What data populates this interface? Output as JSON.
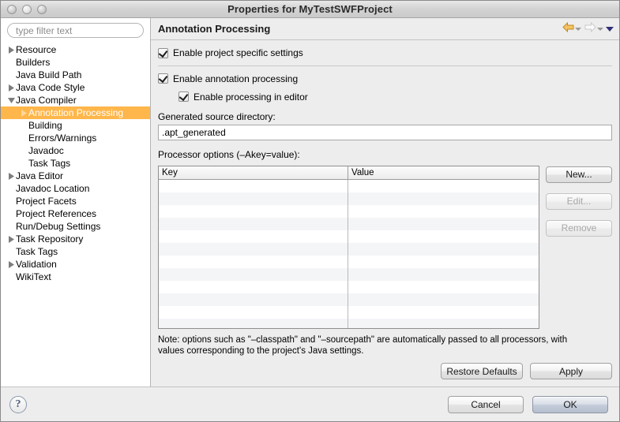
{
  "window": {
    "title": "Properties for MyTestSWFProject",
    "controls": [
      "close-button",
      "minimize-button",
      "zoom-button"
    ]
  },
  "sidebar": {
    "filter": {
      "value": "",
      "placeholder": "type filter text"
    },
    "items": [
      {
        "label": "Resource",
        "depth": 0,
        "twisty": "collapsed",
        "selected": false
      },
      {
        "label": "Builders",
        "depth": 0,
        "twisty": "none",
        "selected": false
      },
      {
        "label": "Java Build Path",
        "depth": 0,
        "twisty": "none",
        "selected": false
      },
      {
        "label": "Java Code Style",
        "depth": 0,
        "twisty": "collapsed",
        "selected": false
      },
      {
        "label": "Java Compiler",
        "depth": 0,
        "twisty": "expanded",
        "selected": false
      },
      {
        "label": "Annotation Processing",
        "depth": 1,
        "twisty": "collapsed",
        "selected": true
      },
      {
        "label": "Building",
        "depth": 1,
        "twisty": "none",
        "selected": false
      },
      {
        "label": "Errors/Warnings",
        "depth": 1,
        "twisty": "none",
        "selected": false
      },
      {
        "label": "Javadoc",
        "depth": 1,
        "twisty": "none",
        "selected": false
      },
      {
        "label": "Task Tags",
        "depth": 1,
        "twisty": "none",
        "selected": false
      },
      {
        "label": "Java Editor",
        "depth": 0,
        "twisty": "collapsed",
        "selected": false
      },
      {
        "label": "Javadoc Location",
        "depth": 0,
        "twisty": "none",
        "selected": false
      },
      {
        "label": "Project Facets",
        "depth": 0,
        "twisty": "none",
        "selected": false
      },
      {
        "label": "Project References",
        "depth": 0,
        "twisty": "none",
        "selected": false
      },
      {
        "label": "Run/Debug Settings",
        "depth": 0,
        "twisty": "none",
        "selected": false
      },
      {
        "label": "Task Repository",
        "depth": 0,
        "twisty": "collapsed",
        "selected": false
      },
      {
        "label": "Task Tags",
        "depth": 0,
        "twisty": "none",
        "selected": false
      },
      {
        "label": "Validation",
        "depth": 0,
        "twisty": "collapsed",
        "selected": false
      },
      {
        "label": "WikiText",
        "depth": 0,
        "twisty": "none",
        "selected": false
      }
    ]
  },
  "page": {
    "title": "Annotation Processing",
    "nav": {
      "back_icon": "back-arrow-icon",
      "back_enabled": true,
      "forward_icon": "forward-arrow-icon",
      "forward_enabled": false,
      "menu_icon": "chevron-down-icon"
    },
    "checkboxes": [
      {
        "label": "Enable project specific settings",
        "checked": true
      },
      {
        "label": "Enable annotation processing",
        "checked": true
      },
      {
        "label": "Enable processing in editor",
        "checked": true
      }
    ],
    "generated_dir": {
      "label": "Generated source directory:",
      "value": ".apt_generated",
      "placeholder": ""
    },
    "processor_options": {
      "label": "Processor options (–Akey=value):",
      "columns": [
        "Key",
        "Value"
      ],
      "rows": [],
      "row_count": 12
    },
    "side_buttons": [
      {
        "label": "New...",
        "enabled": true
      },
      {
        "label": "Edit...",
        "enabled": false
      },
      {
        "label": "Remove",
        "enabled": false
      }
    ],
    "note_line1": "Note: options such as \"–classpath\" and \"–sourcepath\" are automatically passed to all processors, with",
    "note_line2": "values corresponding to the project's Java settings.",
    "apply_buttons": [
      {
        "label": "Restore Defaults",
        "enabled": true
      },
      {
        "label": "Apply",
        "enabled": true
      }
    ]
  },
  "footer": {
    "help_label": "?",
    "buttons": [
      {
        "label": "Cancel",
        "default": false
      },
      {
        "label": "OK",
        "default": true
      }
    ]
  },
  "colors": {
    "selection": "#ffb64a",
    "window_bg": "#ededed",
    "tree_bg": "#ffffff",
    "table_stripe": "#f4f5f7",
    "back_arrow": "#e8a33d",
    "help_icon": "#4a5d78"
  }
}
